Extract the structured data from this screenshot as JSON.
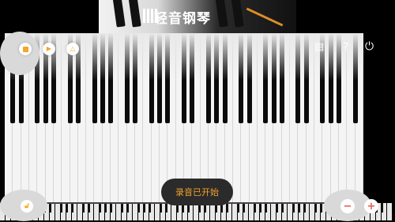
{
  "banner": {
    "title": "轻音钢琴"
  },
  "controls": {
    "stop_icon": "stop-icon",
    "play_icon": "play-icon",
    "metronome_icon": "metronome-icon"
  },
  "top_right": {
    "record_list_icon": "record-list-icon",
    "help": "?",
    "power_icon": "power-icon"
  },
  "toast": {
    "text": "录音已开始"
  },
  "bottom": {
    "minus": "−",
    "plus": "+"
  },
  "colors": {
    "accent": "#f5a623",
    "toast_bg": "#2b2b2b",
    "zoom": "#e45b4b"
  }
}
